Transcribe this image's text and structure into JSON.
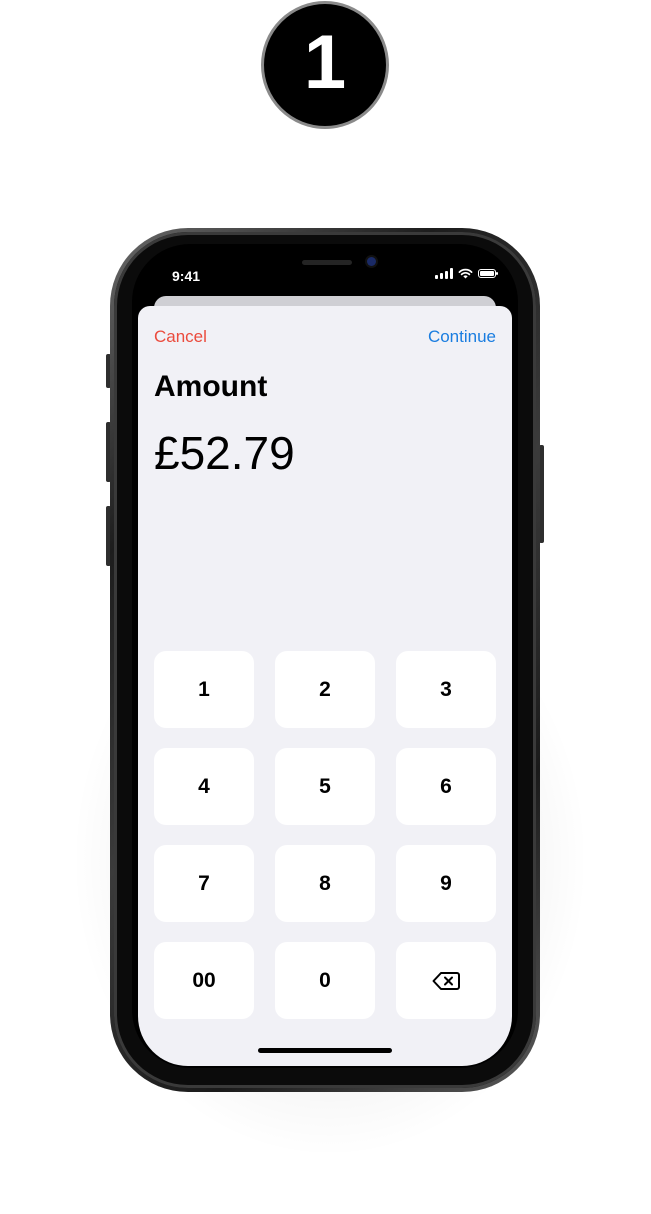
{
  "step": {
    "number": "1"
  },
  "status_bar": {
    "time": "9:41",
    "icons": [
      "cellular-signal-icon",
      "wifi-icon",
      "battery-icon"
    ]
  },
  "nav": {
    "cancel_label": "Cancel",
    "continue_label": "Continue"
  },
  "amount": {
    "label": "Amount",
    "value": "£52.79"
  },
  "keypad": {
    "keys": [
      "1",
      "2",
      "3",
      "4",
      "5",
      "6",
      "7",
      "8",
      "9",
      "00",
      "0"
    ],
    "delete_icon": "backspace-icon"
  },
  "colors": {
    "cancel": "#eb4b3d",
    "continue": "#1a7de0",
    "sheet_background": "#f1f1f6",
    "key_background": "#ffffff"
  }
}
